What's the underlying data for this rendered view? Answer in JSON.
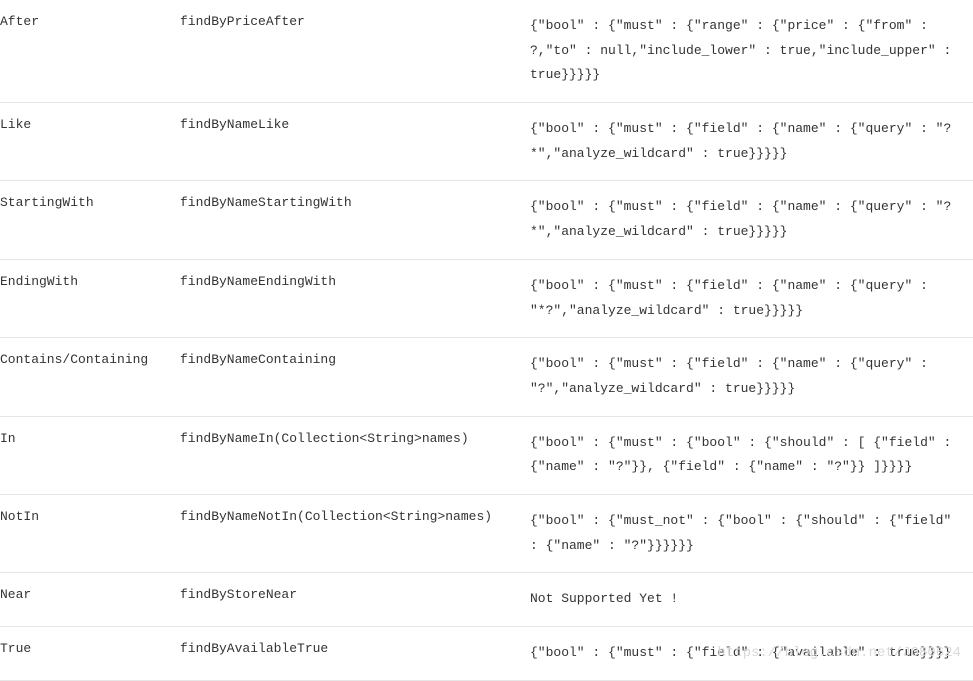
{
  "rows": [
    {
      "keyword": "After",
      "method": "findByPriceAfter",
      "query": "{\"bool\" : {\"must\" : {\"range\" : {\"price\" : {\"from\" : ?,\"to\" : null,\"include_lower\" : true,\"include_upper\" : true}}}}}"
    },
    {
      "keyword": "Like",
      "method": "findByNameLike",
      "query": "{\"bool\" : {\"must\" : {\"field\" : {\"name\" : {\"query\" : \"?*\",\"analyze_wildcard\" : true}}}}}"
    },
    {
      "keyword": "StartingWith",
      "method": "findByNameStartingWith",
      "query": "{\"bool\" : {\"must\" : {\"field\" : {\"name\" : {\"query\" : \"?*\",\"analyze_wildcard\" : true}}}}}"
    },
    {
      "keyword": "EndingWith",
      "method": "findByNameEndingWith",
      "query": "{\"bool\" : {\"must\" : {\"field\" : {\"name\" : {\"query\" : \"*?\",\"analyze_wildcard\" : true}}}}}"
    },
    {
      "keyword": "Contains/Containing",
      "method": "findByNameContaining",
      "query": "{\"bool\" : {\"must\" : {\"field\" : {\"name\" : {\"query\" : \"?\",\"analyze_wildcard\" : true}}}}}"
    },
    {
      "keyword": "In",
      "method": "findByNameIn(Collection<String>names)",
      "query": "{\"bool\" : {\"must\" : {\"bool\" : {\"should\" : [ {\"field\" : {\"name\" : \"?\"}}, {\"field\" : {\"name\" : \"?\"}} ]}}}}"
    },
    {
      "keyword": "NotIn",
      "method": "findByNameNotIn(Collection<String>names)",
      "query": "{\"bool\" : {\"must_not\" : {\"bool\" : {\"should\" : {\"field\" : {\"name\" : \"?\"}}}}}}"
    },
    {
      "keyword": "Near",
      "method": "findByStoreNear",
      "query": "Not Supported Yet !"
    },
    {
      "keyword": "True",
      "method": "findByAvailableTrue",
      "query": "{\"bool\" : {\"must\" : {\"field\" : {\"available\" : true}}}}"
    }
  ],
  "watermark": "https://blog.csdn.net/J080624"
}
